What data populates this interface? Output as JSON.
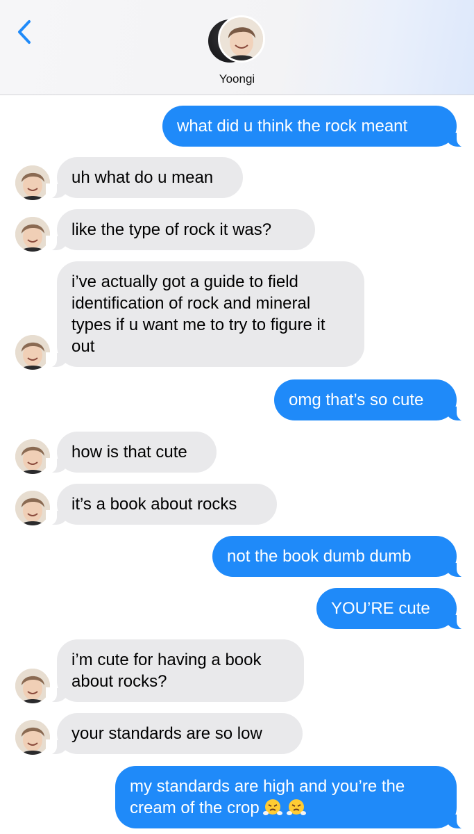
{
  "header": {
    "contact_name": "Yoongi",
    "back_icon": "chevron-left-icon"
  },
  "colors": {
    "sent_bubble": "#1f8af9",
    "received_bubble": "#e9e9eb",
    "accent": "#1f8af9"
  },
  "messages": [
    {
      "from": "me",
      "text": "what did u think the rock meant"
    },
    {
      "from": "them",
      "text": "uh what do u mean"
    },
    {
      "from": "them",
      "text": "like the type of rock it was?"
    },
    {
      "from": "them",
      "text": "i’ve actually got a guide to field identification of rock and mineral types if u want me to try to figure it out"
    },
    {
      "from": "me",
      "text": "omg that’s so cute"
    },
    {
      "from": "them",
      "text": "how is that cute"
    },
    {
      "from": "them",
      "text": "it’s a book about rocks"
    },
    {
      "from": "me",
      "text": "not the book dumb dumb"
    },
    {
      "from": "me",
      "text": "YOU’RE cute"
    },
    {
      "from": "them",
      "text": "i’m cute for having a book about rocks?"
    },
    {
      "from": "them",
      "text": "your standards are so low"
    },
    {
      "from": "me",
      "text": "my standards are high and you’re the cream of the crop",
      "emoji": [
        "face-with-steam-icon",
        "face-with-steam-icon"
      ]
    }
  ]
}
